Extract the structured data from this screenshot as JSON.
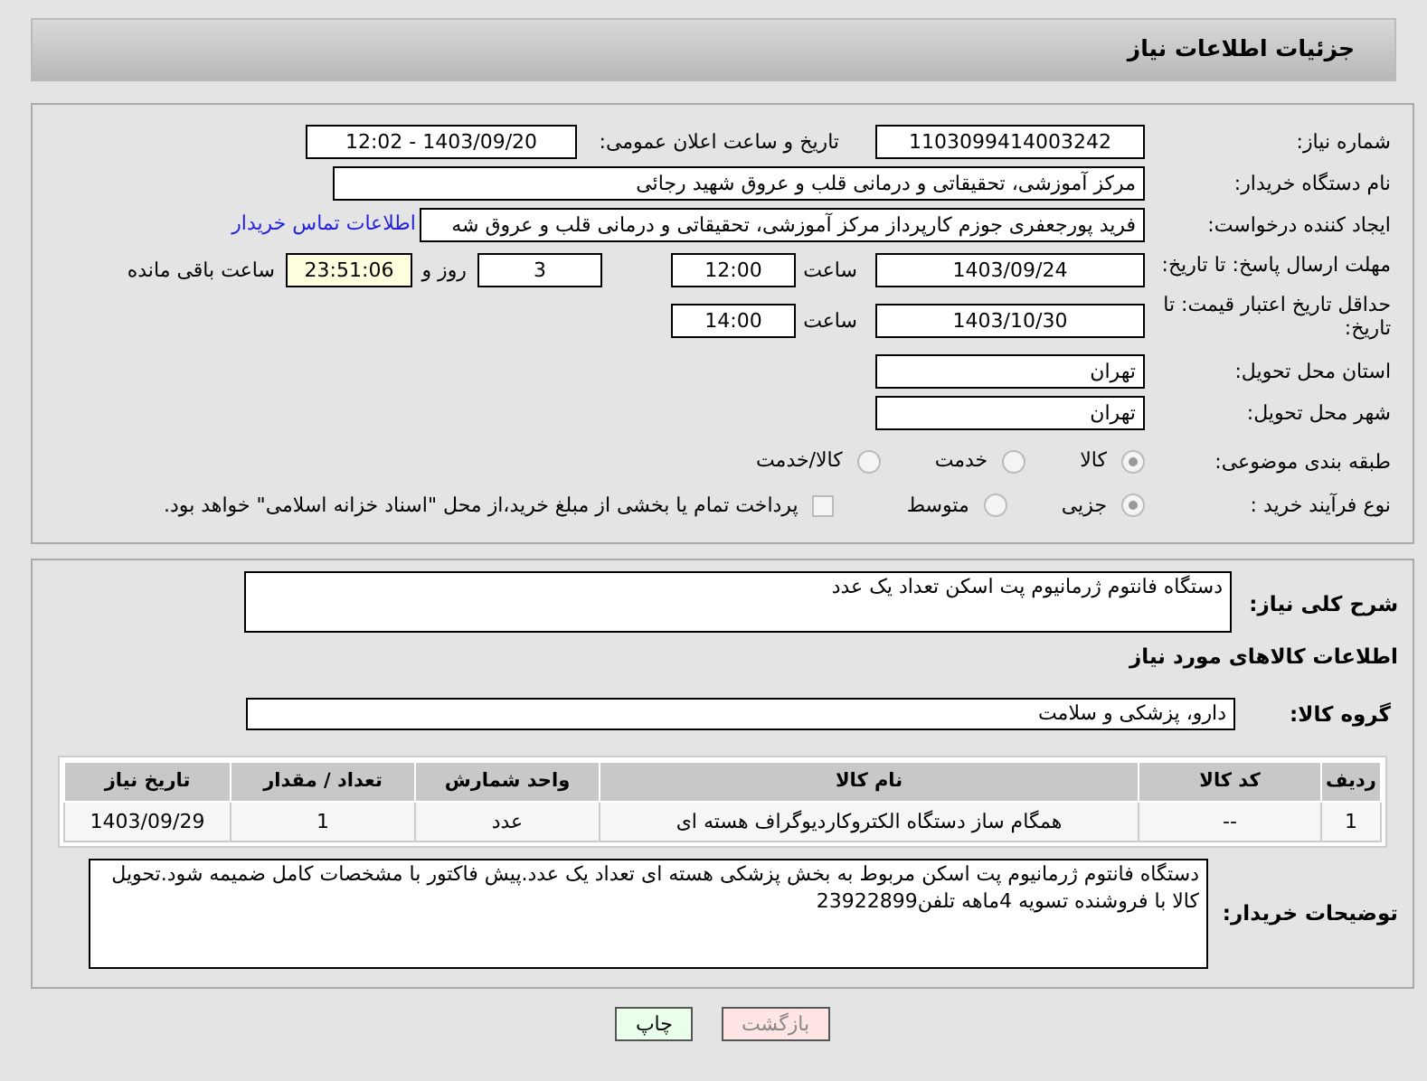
{
  "header": {
    "title": "جزئیات اطلاعات نیاز"
  },
  "need_number": {
    "label": "شماره نیاز:",
    "value": "1103099414003242"
  },
  "announce_date": {
    "label": "تاریخ و ساعت اعلان عمومی:",
    "value": "1403/09/20 - 12:02"
  },
  "buyer_org": {
    "label": "نام دستگاه خریدار:",
    "value": "مرکز آموزشی، تحقیقاتی و درمانی قلب و عروق شهید رجائی"
  },
  "requester": {
    "label": "ایجاد کننده درخواست:",
    "value": "فرید پورجعفری جوزم کارپرداز  مرکز آموزشی، تحقیقاتی و درمانی قلب و عروق شه",
    "link": "اطلاعات تماس خریدار"
  },
  "reply_deadline": {
    "label": "مهلت ارسال پاسخ: تا تاریخ:",
    "date": "1403/09/24",
    "time_label": "ساعت",
    "time": "12:00",
    "days": "3",
    "days_label": "روز و",
    "remaining": "23:51:06",
    "remaining_label": "ساعت باقی مانده"
  },
  "price_validity": {
    "label": "حداقل تاریخ اعتبار قیمت: تا تاریخ:",
    "date": "1403/10/30",
    "time_label": "ساعت",
    "time": "14:00"
  },
  "province": {
    "label": "استان محل تحویل:",
    "value": "تهران"
  },
  "city": {
    "label": "شهر محل تحویل:",
    "value": "تهران"
  },
  "category": {
    "label": "طبقه بندی موضوعی:",
    "options": [
      {
        "label": "کالا",
        "selected": true
      },
      {
        "label": "خدمت",
        "selected": false
      },
      {
        "label": "کالا/خدمت",
        "selected": false
      }
    ]
  },
  "process": {
    "label": "نوع فرآیند خرید :",
    "options": [
      {
        "label": "جزیی",
        "selected": true
      },
      {
        "label": "متوسط",
        "selected": false
      }
    ],
    "payment_checkbox": {
      "label": "پرداخت تمام یا بخشی از مبلغ خرید،از محل \"اسناد خزانه اسلامی\" خواهد بود.",
      "checked": false
    }
  },
  "summary": {
    "label": "شرح کلی نیاز:",
    "value": "دستگاه فانتوم ژرمانیوم پت اسکن تعداد یک عدد"
  },
  "goods_heading": "اطلاعات کالاهای مورد نیاز",
  "goods_group": {
    "label": "گروه کالا:",
    "value": "دارو، پزشکی و سلامت"
  },
  "table": {
    "columns": [
      "ردیف",
      "کد کالا",
      "نام کالا",
      "واحد شمارش",
      "تعداد / مقدار",
      "تاریخ نیاز"
    ],
    "rows": [
      [
        "1",
        "--",
        "همگام ساز دستگاه الکتروکاردیوگراف هسته ای",
        "عدد",
        "1",
        "1403/09/29"
      ]
    ]
  },
  "buyer_notes": {
    "label": "توضیحات خریدار:",
    "value": "دستگاه فانتوم ژرمانیوم پت اسکن مربوط به بخش پزشکی هسته ای تعداد یک عدد.پیش فاکتور با مشخصات کامل ضمیمه شود.تحویل کالا با فروشنده تسویه 4ماهه تلفن23922899"
  },
  "buttons": [
    {
      "label": "بازگشت",
      "kind": "back"
    },
    {
      "label": "چاپ",
      "kind": "print"
    }
  ]
}
